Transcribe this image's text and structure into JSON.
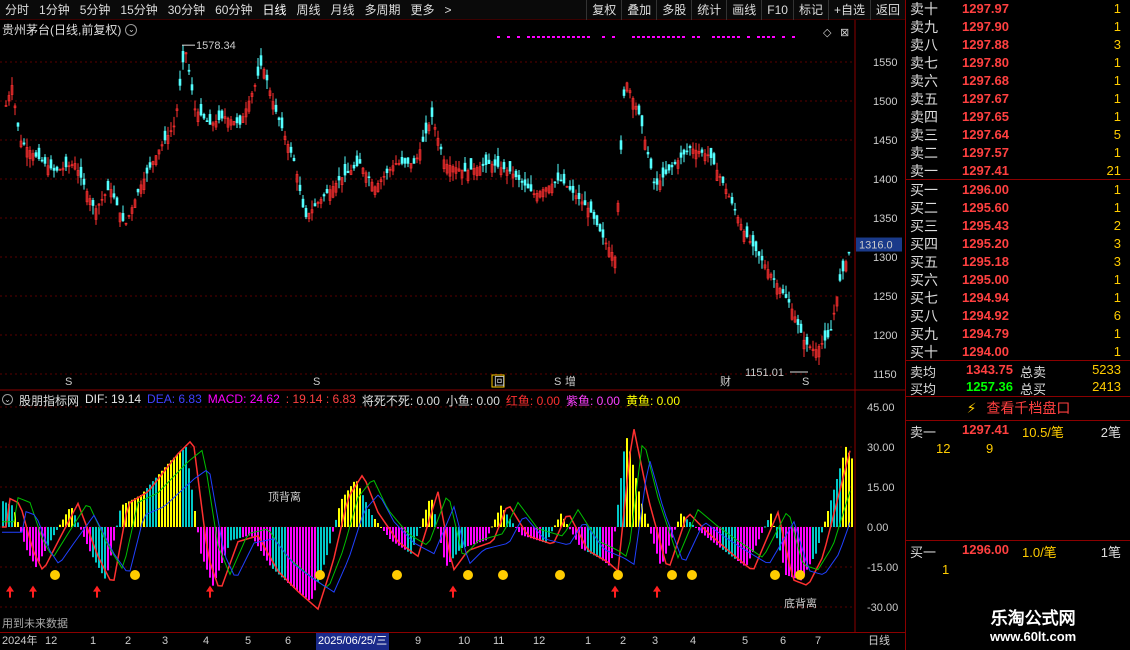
{
  "toolbar": {
    "periods": [
      "分时",
      "1分钟",
      "5分钟",
      "15分钟",
      "30分钟",
      "60分钟",
      "日线",
      "周线",
      "月线",
      "多周期",
      "更多"
    ],
    "active_index": 6,
    "more_arrow": ">",
    "right_actions": [
      "复权",
      "叠加",
      "多股",
      "统计",
      "画线",
      "F10",
      "标记",
      "+自选",
      "返回"
    ]
  },
  "main_chart": {
    "title": "贵州茅台(日线,前复权)",
    "y_ticks": [
      "1550",
      "1500",
      "1450",
      "1400",
      "1350",
      "1300",
      "1250",
      "1200",
      "1150"
    ],
    "current_price_tag": "1316.0",
    "high_label": "1578.34",
    "low_label": "1151.01",
    "markers": [
      "S",
      "S",
      "回",
      "S",
      "增",
      "财",
      "S"
    ]
  },
  "indicator": {
    "name": "股朋指标网",
    "dif_label": "DIF: 19.14",
    "dea_label": "DEA: 6.83",
    "macd_label": "MACD: 24.62",
    "macd_extra": ": 19.14  : 6.83",
    "jiang_label": "将死不死: 0.00",
    "xiaoyu_label": "小鱼: 0.00",
    "hongyu_label": "红鱼: 0.00",
    "ziyu_label": "紫鱼: 0.00",
    "huangyu_label": "黄鱼: 0.00",
    "y_ticks": [
      "45.00",
      "30.00",
      "15.00",
      "0.00",
      "-15.00",
      "-30.00"
    ],
    "annotations": {
      "top_div": "顶背离",
      "bottom_div": "底背离"
    },
    "footer_note": "用到未来数据",
    "colors": {
      "dif": "#e8e8e8",
      "dea": "#ffff00",
      "macd": "#ff00ff",
      "green": "#00c000",
      "red": "#ff3030",
      "yellow": "#ffff00",
      "cyan": "#00cccc",
      "magenta": "#ff00ff"
    }
  },
  "timebar": {
    "labels": [
      "2024年",
      "12",
      "1",
      "2",
      "3",
      "4",
      "5",
      "6",
      "2025/06/25/三",
      "9",
      "10",
      "11",
      "12",
      "1",
      "2",
      "3",
      "4",
      "5",
      "6",
      "7"
    ],
    "period": "日线"
  },
  "order_book": {
    "sells": [
      {
        "label": "卖十",
        "price": "1297.97",
        "vol": "1"
      },
      {
        "label": "卖九",
        "price": "1297.90",
        "vol": "1"
      },
      {
        "label": "卖八",
        "price": "1297.88",
        "vol": "3"
      },
      {
        "label": "卖七",
        "price": "1297.80",
        "vol": "1"
      },
      {
        "label": "卖六",
        "price": "1297.68",
        "vol": "1"
      },
      {
        "label": "卖五",
        "price": "1297.67",
        "vol": "1"
      },
      {
        "label": "卖四",
        "price": "1297.65",
        "vol": "1"
      },
      {
        "label": "卖三",
        "price": "1297.64",
        "vol": "5"
      },
      {
        "label": "卖二",
        "price": "1297.57",
        "vol": "1"
      },
      {
        "label": "卖一",
        "price": "1297.41",
        "vol": "21"
      }
    ],
    "buys": [
      {
        "label": "买一",
        "price": "1296.00",
        "vol": "1"
      },
      {
        "label": "买二",
        "price": "1295.60",
        "vol": "1"
      },
      {
        "label": "买三",
        "price": "1295.43",
        "vol": "2"
      },
      {
        "label": "买四",
        "price": "1295.20",
        "vol": "3"
      },
      {
        "label": "买五",
        "price": "1295.18",
        "vol": "3"
      },
      {
        "label": "买六",
        "price": "1295.00",
        "vol": "1"
      },
      {
        "label": "买七",
        "price": "1294.94",
        "vol": "1"
      },
      {
        "label": "买八",
        "price": "1294.92",
        "vol": "6"
      },
      {
        "label": "买九",
        "price": "1294.79",
        "vol": "1"
      },
      {
        "label": "买十",
        "price": "1294.00",
        "vol": "1"
      }
    ],
    "avg_sell_label": "卖均",
    "avg_sell_price": "1343.75",
    "total_sell_label": "总卖",
    "total_sell": "5233",
    "avg_buy_label": "买均",
    "avg_buy_price": "1257.36",
    "total_buy_label": "总买",
    "total_buy": "2413",
    "view_depth": "查看千档盘口",
    "ask1_label": "卖一",
    "ask1_price": "1297.41",
    "ask1_size": "10.5/笔",
    "ask1_count": "2笔",
    "ask1_q1": "12",
    "ask1_q2": "9",
    "bid1_label": "买一",
    "bid1_price": "1296.00",
    "bid1_size": "1.0/笔",
    "bid1_count": "1笔",
    "bid1_q1": "1"
  },
  "brand": {
    "line1": "乐淘公式网",
    "line2": "www.60lt.com"
  }
}
